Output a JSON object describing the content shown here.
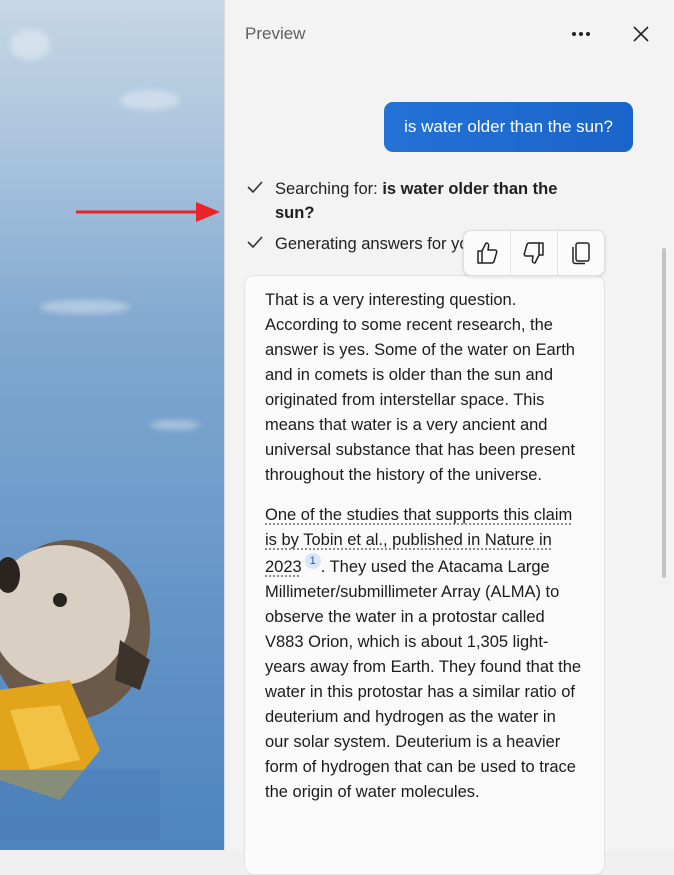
{
  "panel": {
    "title": "Preview"
  },
  "icons": {
    "more": "more-horizontal-icon",
    "close": "close-icon",
    "check": "checkmark-icon",
    "like": "thumbs-up-icon",
    "dislike": "thumbs-down-icon",
    "copy": "copy-icon",
    "arrow": "red-arrow-annotation"
  },
  "colors": {
    "user_bubble": "#1b6ac9",
    "arrow": "#e8232a",
    "citation_badge": "#d7e6f8"
  },
  "conversation": {
    "user_message": "is water older than the sun?",
    "progress": [
      {
        "prefix": "Searching for: ",
        "bold": "is water older than the sun?"
      },
      {
        "prefix": "Generating answers for you"
      }
    ],
    "answer": {
      "p1": "That is a very interesting question. According to some recent research, the answer is yes. Some of the water on Earth and in comets is older than the sun and originated from interstellar space. This means that water is a very ancient and universal substance that has been present throughout the history of the universe.",
      "p2_link": "One of the studies that supports this claim is by Tobin et al., published in Nature in 2023",
      "p2_cite": "1",
      "p2_rest": ". They used the Atacama Large Millimeter/submillimeter Array (ALMA) to observe the water in a protostar called V883 Orion, which is about 1,305 light-years away from Earth. They found that the water in this protostar has a similar ratio of deuterium and hydrogen as the water in our solar system. Deuterium is a heavier form of hydrogen that can be used to trace the origin of water molecules."
    }
  }
}
